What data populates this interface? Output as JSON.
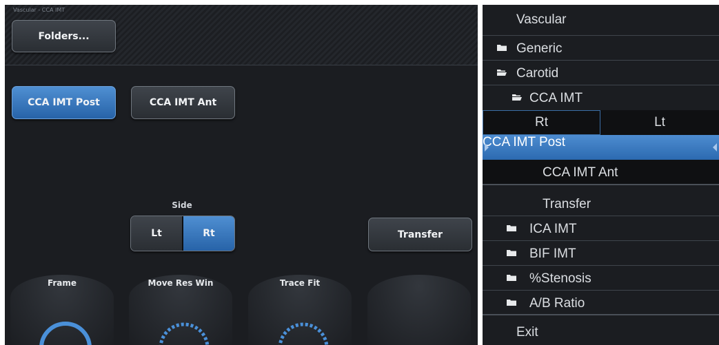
{
  "left_panel": {
    "mode_label": "Vascular - CCA IMT",
    "folders_button": "Folders...",
    "presets": [
      {
        "label": "CCA IMT Post",
        "active": true
      },
      {
        "label": "CCA IMT Ant",
        "active": false
      }
    ],
    "side": {
      "label": "Side",
      "options": [
        {
          "label": "Lt",
          "active": false
        },
        {
          "label": "Rt",
          "active": true
        }
      ]
    },
    "transfer_button": "Transfer",
    "knobs": [
      {
        "label": "Frame",
        "style": "solid"
      },
      {
        "label": "Move Res Win",
        "style": "dashed"
      },
      {
        "label": "Trace Fit",
        "style": "dashed"
      },
      {
        "label": "",
        "style": "none"
      }
    ],
    "colors": {
      "accent": "#2d6db3",
      "panel": "#1b1d21",
      "knob_arc": "#4a90d9"
    }
  },
  "right_menu": {
    "title": "Vascular",
    "items": [
      {
        "label": "Generic",
        "icon": "folder-closed-icon"
      },
      {
        "label": "Carotid",
        "icon": "folder-open-icon"
      },
      {
        "label": "CCA IMT",
        "icon": "folder-open-icon"
      }
    ],
    "side_options": [
      "Rt",
      "Lt"
    ],
    "selected_item": "CCA IMT Post",
    "other_item": "CCA IMT Ant",
    "transfer": "Transfer",
    "folders": [
      {
        "label": "ICA IMT",
        "icon": "folder-closed-icon"
      },
      {
        "label": "BIF IMT",
        "icon": "folder-closed-icon"
      },
      {
        "label": "%Stenosis",
        "icon": "folder-closed-icon"
      },
      {
        "label": "A/B Ratio",
        "icon": "folder-closed-icon"
      }
    ],
    "exit": "Exit"
  }
}
